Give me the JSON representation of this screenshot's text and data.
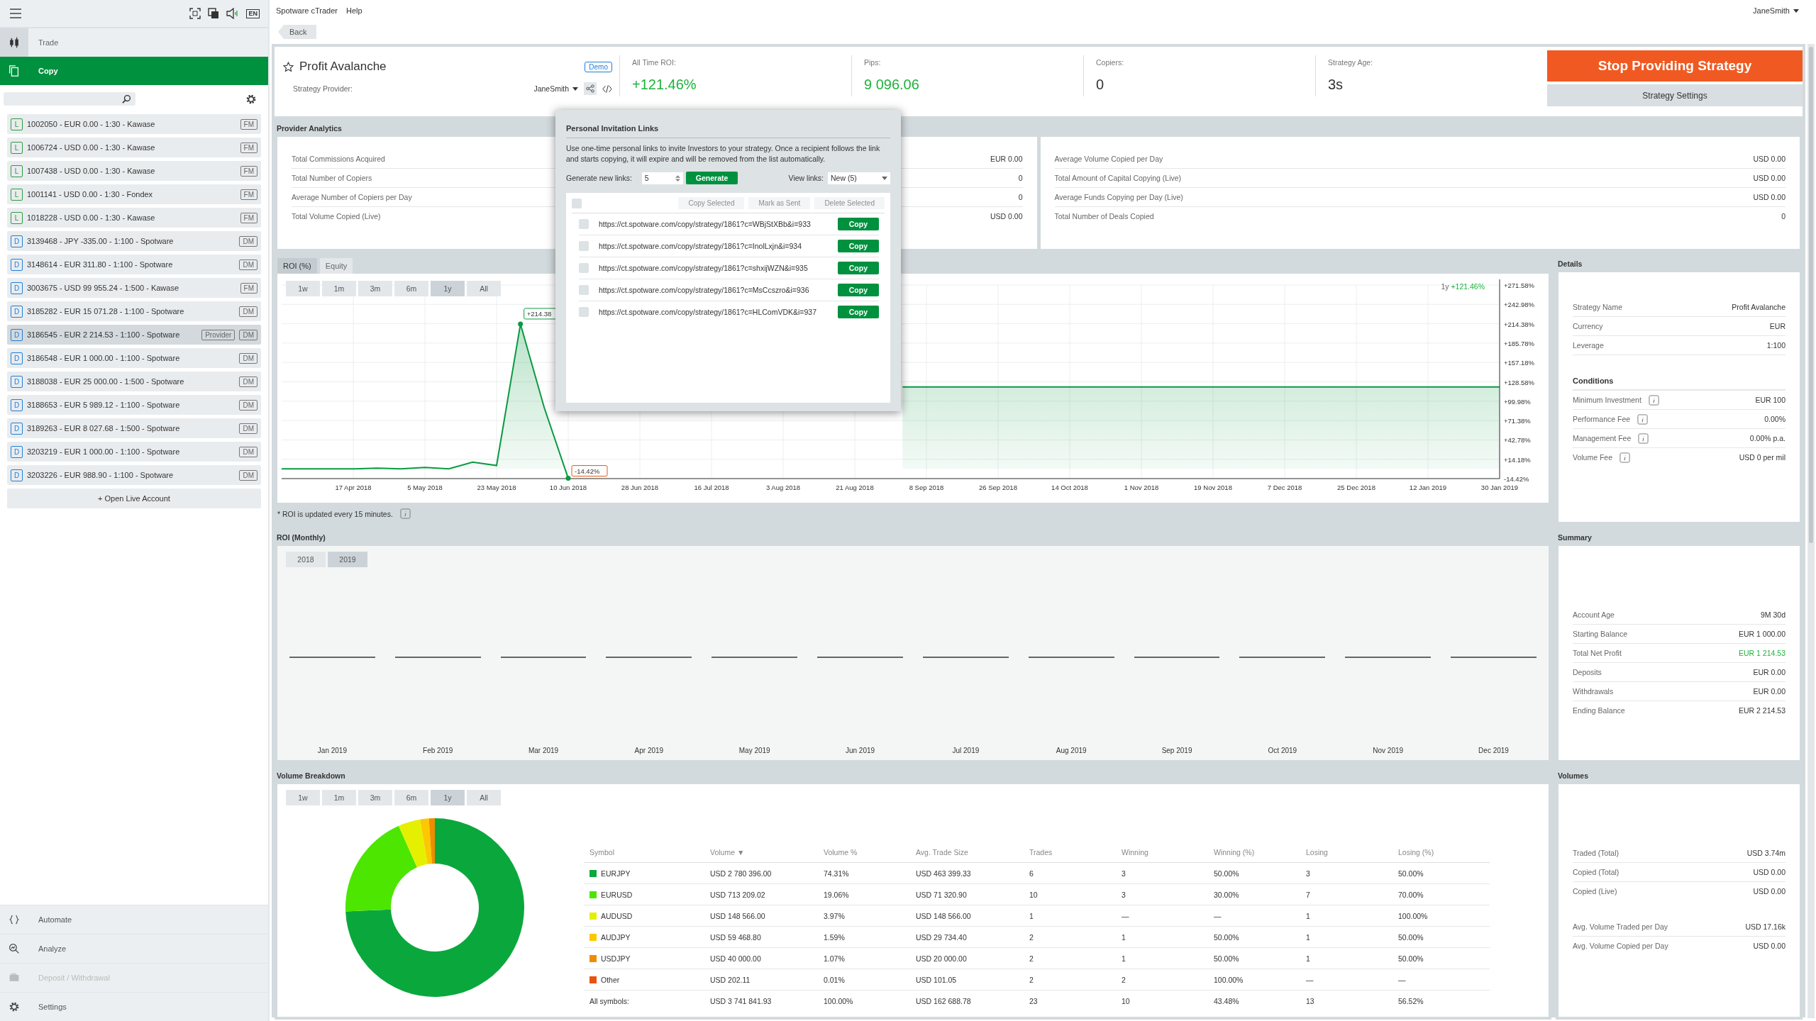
{
  "menu_bar": {
    "items": [
      "Spotware cTrader",
      "Help"
    ],
    "user": "JaneSmith",
    "language": "EN"
  },
  "sidebar": {
    "nav": [
      {
        "label": "Trade",
        "selected": false
      },
      {
        "label": "Copy",
        "selected": true
      }
    ],
    "accounts": [
      {
        "badge": "L",
        "kind": "live",
        "text": "1002050 - EUR 0.00 - 1:30 - Kawase",
        "tags": [
          "FM"
        ],
        "selected": false
      },
      {
        "badge": "L",
        "kind": "live",
        "text": "1006724 - USD 0.00 - 1:30 - Kawase",
        "tags": [
          "FM"
        ],
        "selected": false
      },
      {
        "badge": "L",
        "kind": "live",
        "text": "1007438 - USD 0.00 - 1:30 - Kawase",
        "tags": [
          "FM"
        ],
        "selected": false
      },
      {
        "badge": "L",
        "kind": "live",
        "text": "1001141 - USD 0.00 - 1:30 - Fondex",
        "tags": [
          "FM"
        ],
        "selected": false
      },
      {
        "badge": "L",
        "kind": "live",
        "text": "1018228 - USD 0.00 - 1:30 - Kawase",
        "tags": [
          "FM"
        ],
        "selected": false
      },
      {
        "badge": "D",
        "kind": "demo",
        "text": "3139468 - JPY -335.00 - 1:100 - Spotware",
        "tags": [
          "DM"
        ],
        "selected": false
      },
      {
        "badge": "D",
        "kind": "demo",
        "text": "3148614 - EUR 311.80 - 1:100 - Spotware",
        "tags": [
          "DM"
        ],
        "selected": false
      },
      {
        "badge": "D",
        "kind": "demo",
        "text": "3003675 - USD 99 955.24 - 1:500 - Kawase",
        "tags": [
          "FM"
        ],
        "selected": false
      },
      {
        "badge": "D",
        "kind": "demo",
        "text": "3185282 - EUR 15 071.28 - 1:100 - Spotware",
        "tags": [
          "DM"
        ],
        "selected": false
      },
      {
        "badge": "D",
        "kind": "demo",
        "text": "3186545 - EUR 2 214.53 - 1:100 - Spotware",
        "tags": [
          "Provider",
          "DM"
        ],
        "selected": true
      },
      {
        "badge": "D",
        "kind": "demo",
        "text": "3186548 - EUR 1 000.00 - 1:100 - Spotware",
        "tags": [
          "DM"
        ],
        "selected": false
      },
      {
        "badge": "D",
        "kind": "demo",
        "text": "3188038 - EUR 25 000.00 - 1:500 - Spotware",
        "tags": [
          "DM"
        ],
        "selected": false
      },
      {
        "badge": "D",
        "kind": "demo",
        "text": "3188653 - EUR 5 989.12 - 1:100 - Spotware",
        "tags": [
          "DM"
        ],
        "selected": false
      },
      {
        "badge": "D",
        "kind": "demo",
        "text": "3189263 - EUR 8 027.68 - 1:500 - Spotware",
        "tags": [
          "DM"
        ],
        "selected": false
      },
      {
        "badge": "D",
        "kind": "demo",
        "text": "3203219 - EUR 1 000.00 - 1:100 - Spotware",
        "tags": [
          "DM"
        ],
        "selected": false
      },
      {
        "badge": "D",
        "kind": "demo",
        "text": "3203226 - EUR 988.90 - 1:100 - Spotware",
        "tags": [
          "DM"
        ],
        "selected": false
      }
    ],
    "open_account": "+ Open Live Account",
    "bottom_nav": [
      {
        "label": "Automate",
        "disabled": false
      },
      {
        "label": "Analyze",
        "disabled": false
      },
      {
        "label": "Deposit / Withdrawal",
        "disabled": true
      },
      {
        "label": "Settings",
        "disabled": false
      }
    ]
  },
  "back": "Back",
  "strategy": {
    "name": "Profit Avalanche",
    "account_type": "Demo",
    "provider_label": "Strategy Provider:",
    "provider": "JaneSmith",
    "stats": [
      {
        "label": "All Time ROI:",
        "value": "+121.46%",
        "positive": true
      },
      {
        "label": "Pips:",
        "value": "9 096.06",
        "positive": true
      },
      {
        "label": "Copiers:",
        "value": "0",
        "positive": false
      },
      {
        "label": "Strategy Age:",
        "value": "3s",
        "positive": false
      }
    ],
    "primary_action": "Stop Providing Strategy",
    "secondary_action": "Strategy Settings"
  },
  "provider_analytics": {
    "title": "Provider Analytics",
    "left": [
      {
        "label": "Total Commissions Acquired",
        "value": "EUR 0.00"
      },
      {
        "label": "Total Number of Copiers",
        "value": "0"
      },
      {
        "label": "Average Number of Copiers per Day",
        "value": "0"
      },
      {
        "label": "Total Volume Copied (Live)",
        "value": "USD 0.00"
      }
    ],
    "right": [
      {
        "label": "Average Volume Copied per Day",
        "value": "USD 0.00"
      },
      {
        "label": "Total Amount of Capital Copying (Live)",
        "value": "USD 0.00"
      },
      {
        "label": "Average Funds Copying per Day (Live)",
        "value": "USD 0.00"
      },
      {
        "label": "Total Number of Deals Copied",
        "value": "0"
      }
    ]
  },
  "roi_chart": {
    "tabs": [
      {
        "label": "ROI (%)",
        "selected": true
      },
      {
        "label": "Equity",
        "selected": false
      }
    ],
    "ranges": [
      {
        "label": "1w",
        "selected": false
      },
      {
        "label": "1m",
        "selected": false
      },
      {
        "label": "3m",
        "selected": false
      },
      {
        "label": "6m",
        "selected": false
      },
      {
        "label": "1y",
        "selected": true
      },
      {
        "label": "All",
        "selected": false
      }
    ],
    "period_label": "1y",
    "period_value": "+121.46%",
    "chart_data": {
      "type": "area",
      "grid": true,
      "ylim": [
        -14.42,
        271.58
      ],
      "categories": [
        null,
        null,
        null,
        "17 Apr 2018",
        null,
        null,
        "5 May 2018",
        null,
        null,
        "23 May 2018",
        null,
        null,
        "10 Jun 2018",
        null,
        null,
        "28 Jun 2018",
        null,
        null,
        "16 Jul 2018",
        null,
        null,
        "3 Aug 2018",
        null,
        null,
        "21 Aug 2018",
        null,
        null,
        "8 Sep 2018",
        null,
        null,
        "26 Sep 2018",
        null,
        null,
        "14 Oct 2018",
        null,
        null,
        "1 Nov 2018",
        null,
        null,
        "19 Nov 2018",
        null,
        null,
        "7 Dec 2018",
        null,
        null,
        "25 Dec 2018",
        null,
        null,
        "12 Jan 2019",
        null,
        null,
        "30 Jan 2019"
      ],
      "series": [
        {
          "color": "#0a9a42",
          "values": [
            0,
            0,
            0,
            0,
            1,
            0,
            2,
            0,
            10,
            5,
            214,
            90,
            -14,
            null,
            null,
            null,
            null,
            null,
            null,
            null,
            null,
            null,
            null,
            null,
            null,
            null,
            121,
            121,
            121,
            121,
            121,
            121,
            121,
            121,
            121,
            121,
            121,
            121,
            121,
            121,
            121,
            121,
            121,
            121,
            121,
            121,
            121,
            121,
            121,
            121,
            121,
            121
          ]
        }
      ],
      "yticks": [
        {
          "value": 271.58,
          "label": "+271.58%"
        },
        {
          "value": 242.98,
          "label": "+242.98%"
        },
        {
          "value": 214.38,
          "label": "+214.38%"
        },
        {
          "value": 185.78,
          "label": "+185.78%"
        },
        {
          "value": 157.18,
          "label": "+157.18%"
        },
        {
          "value": 128.58,
          "label": "+128.58%"
        },
        {
          "value": 99.98,
          "label": "+99.98%"
        },
        {
          "value": 71.38,
          "label": "+71.38%"
        },
        {
          "value": 42.78,
          "label": "+42.78%"
        },
        {
          "value": 14.18,
          "label": "+14.18%"
        },
        {
          "value": -14.42,
          "label": "-14.42%"
        }
      ]
    },
    "callouts": [
      {
        "text": "+214.38",
        "kind": "max"
      },
      {
        "text": "-14.42%",
        "kind": "min"
      }
    ],
    "note": "* ROI is updated every 15 minutes."
  },
  "details": {
    "title": "Details",
    "rows": [
      {
        "label": "Strategy Name",
        "value": "Profit Avalanche"
      },
      {
        "label": "Currency",
        "value": "EUR"
      },
      {
        "label": "Leverage",
        "value": "1:100"
      }
    ],
    "conditions_title": "Conditions",
    "conditions": [
      {
        "label": "Minimum Investment",
        "value": "EUR 100"
      },
      {
        "label": "Performance Fee",
        "value": "0.00%"
      },
      {
        "label": "Management Fee",
        "value": "0.00% p.a."
      },
      {
        "label": "Volume Fee",
        "value": "USD 0 per mil"
      }
    ]
  },
  "roi_monthly": {
    "title": "ROI (Monthly)",
    "years": [
      {
        "label": "2018",
        "selected": false
      },
      {
        "label": "2019",
        "selected": true
      }
    ],
    "months": [
      "Jan 2019",
      "Feb 2019",
      "Mar 2019",
      "Apr 2019",
      "May 2019",
      "Jun 2019",
      "Jul 2019",
      "Aug 2019",
      "Sep 2019",
      "Oct 2019",
      "Nov 2019",
      "Dec 2019"
    ]
  },
  "summary": {
    "title": "Summary",
    "rows": [
      {
        "label": "Account Age",
        "value": "9M 30d",
        "positive": false
      },
      {
        "label": "Starting Balance",
        "value": "EUR 1 000.00",
        "positive": false
      },
      {
        "label": "Total Net Profit",
        "value": "EUR 1 214.53",
        "positive": true
      },
      {
        "label": "Deposits",
        "value": "EUR 0.00",
        "positive": false
      },
      {
        "label": "Withdrawals",
        "value": "EUR 0.00",
        "positive": false
      },
      {
        "label": "Ending Balance",
        "value": "EUR 2 214.53",
        "positive": false
      }
    ]
  },
  "volume_breakdown": {
    "title": "Volume Breakdown",
    "ranges": [
      {
        "label": "1w",
        "selected": false
      },
      {
        "label": "1m",
        "selected": false
      },
      {
        "label": "3m",
        "selected": false
      },
      {
        "label": "6m",
        "selected": false
      },
      {
        "label": "1y",
        "selected": true
      },
      {
        "label": "All",
        "selected": false
      }
    ],
    "chart_data": {
      "type": "donut",
      "values": [
        74.31,
        19.06,
        3.97,
        1.59,
        1.07,
        null
      ]
    },
    "columns": [
      "Symbol",
      "Volume ▼",
      "Volume %",
      "Avg. Trade Size",
      "Trades",
      "Winning",
      "Winning (%)",
      "Losing",
      "Losing (%)"
    ],
    "rows": [
      {
        "color": "#0aa83c",
        "cells": [
          "EURJPY",
          "USD 2 780 396.00",
          "74.31%",
          "USD 463 399.33",
          "6",
          "3",
          "50.00%",
          "3",
          "50.00%"
        ]
      },
      {
        "color": "#4ce600",
        "cells": [
          "EURUSD",
          "USD 713 209.02",
          "19.06%",
          "USD 71 320.90",
          "10",
          "3",
          "30.00%",
          "7",
          "70.00%"
        ]
      },
      {
        "color": "#e5f000",
        "cells": [
          "AUDUSD",
          "USD 148 566.00",
          "3.97%",
          "USD 148 566.00",
          "1",
          "—",
          "—",
          "1",
          "100.00%"
        ]
      },
      {
        "color": "#fcc800",
        "cells": [
          "AUDJPY",
          "USD 59 468.80",
          "1.59%",
          "USD 29 734.40",
          "2",
          "1",
          "50.00%",
          "1",
          "50.00%"
        ]
      },
      {
        "color": "#f08c00",
        "cells": [
          "USDJPY",
          "USD 40 000.00",
          "1.07%",
          "USD 20 000.00",
          "2",
          "1",
          "50.00%",
          "1",
          "50.00%"
        ]
      },
      {
        "color": "#e8530e",
        "cells": [
          "Other",
          "USD 202.11",
          "0.01%",
          "USD 101.05",
          "2",
          "2",
          "100.00%",
          "—",
          "—"
        ]
      }
    ],
    "total": {
      "cells": [
        "All symbols:",
        "USD 3 741 841.93",
        "100.00%",
        "USD 162 688.78",
        "23",
        "10",
        "43.48%",
        "13",
        "56.52%"
      ]
    }
  },
  "volumes": {
    "title": "Volumes",
    "groups": [
      [
        {
          "label": "Traded (Total)",
          "value": "USD 3.74m"
        },
        {
          "label": "Copied (Total)",
          "value": "USD 0.00"
        },
        {
          "label": "Copied (Live)",
          "value": "USD 0.00"
        }
      ],
      [
        {
          "label": "Avg. Volume Traded per Day",
          "value": "USD 17.16k"
        },
        {
          "label": "Avg. Volume Copied per Day",
          "value": "USD 0.00"
        }
      ]
    ]
  },
  "modal": {
    "title": "Personal Invitation Links",
    "description": "Use one-time personal links to invite Investors to your strategy. Once a recipient follows the link and starts copying, it will expire and will be removed from the list automatically.",
    "generate_label": "Generate new links:",
    "count": "5",
    "generate_button": "Generate",
    "view_label": "View links:",
    "view_value": "New (5)",
    "select_all": false,
    "bulk_actions": [
      {
        "label": "Copy Selected",
        "disabled": true
      },
      {
        "label": "Mark as Sent",
        "disabled": true
      },
      {
        "label": "Delete Selected",
        "disabled": true
      }
    ],
    "links": [
      {
        "url": "https://ct.spotware.com/copy/strategy/1861?c=WBjStXBb&i=933",
        "checked": false,
        "action": "Copy"
      },
      {
        "url": "https://ct.spotware.com/copy/strategy/1861?c=InolLxjn&i=934",
        "checked": false,
        "action": "Copy"
      },
      {
        "url": "https://ct.spotware.com/copy/strategy/1861?c=shxijWZN&i=935",
        "checked": false,
        "action": "Copy"
      },
      {
        "url": "https://ct.spotware.com/copy/strategy/1861?c=MsCcszro&i=936",
        "checked": false,
        "action": "Copy"
      },
      {
        "url": "https://ct.spotware.com/copy/strategy/1861?c=HLComVDK&i=937",
        "checked": false,
        "action": "Copy"
      }
    ]
  }
}
